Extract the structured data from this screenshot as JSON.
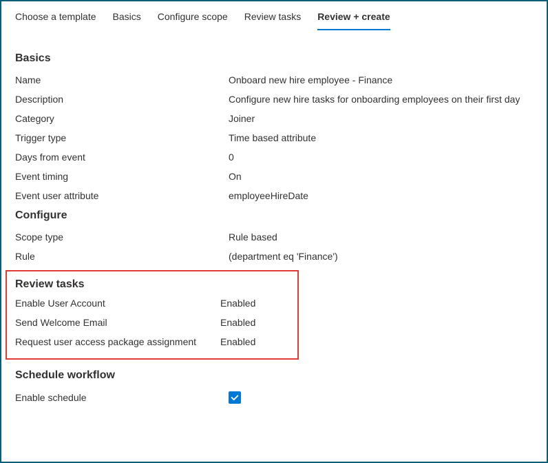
{
  "tabs": {
    "chooseTemplate": "Choose a template",
    "basics": "Basics",
    "configureScope": "Configure scope",
    "reviewTasks": "Review tasks",
    "reviewCreate": "Review + create"
  },
  "sections": {
    "basics": {
      "heading": "Basics",
      "rows": [
        {
          "label": "Name",
          "value": "Onboard new hire employee - Finance"
        },
        {
          "label": "Description",
          "value": "Configure new hire tasks for onboarding employees on their first day"
        },
        {
          "label": "Category",
          "value": "Joiner"
        },
        {
          "label": "Trigger type",
          "value": "Time based attribute"
        },
        {
          "label": "Days from event",
          "value": "0"
        },
        {
          "label": "Event timing",
          "value": "On"
        },
        {
          "label": "Event user attribute",
          "value": "employeeHireDate"
        }
      ]
    },
    "configure": {
      "heading": "Configure",
      "rows": [
        {
          "label": "Scope type",
          "value": "Rule based"
        },
        {
          "label": "Rule",
          "value": " (department eq 'Finance')"
        }
      ]
    },
    "reviewTasks": {
      "heading": "Review tasks",
      "rows": [
        {
          "label": "Enable User Account",
          "value": "Enabled"
        },
        {
          "label": "Send Welcome Email",
          "value": "Enabled"
        },
        {
          "label": "Request user access package assignment",
          "value": "Enabled"
        }
      ]
    },
    "schedule": {
      "heading": "Schedule workflow",
      "enableScheduleLabel": "Enable schedule"
    }
  }
}
